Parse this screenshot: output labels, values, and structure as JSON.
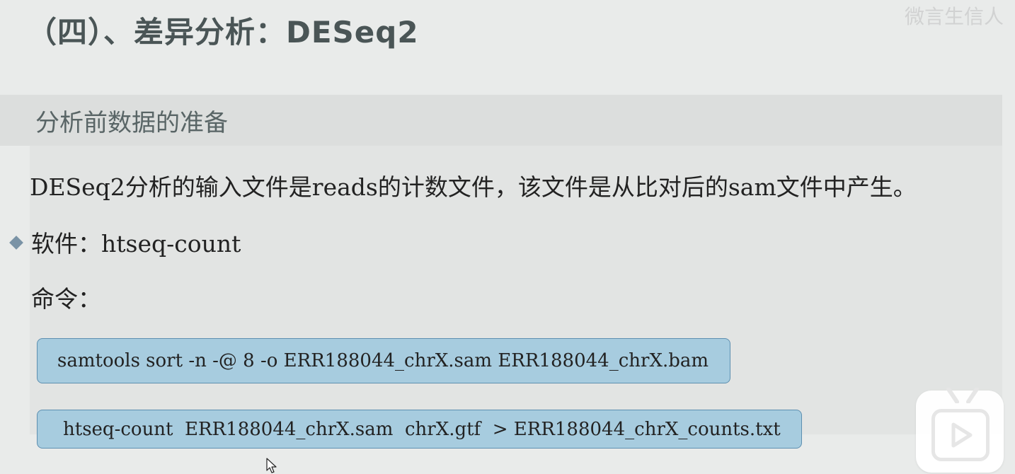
{
  "slide": {
    "title": "（四）、差异分析：DESeq2",
    "watermark": "微言生信人",
    "section_heading": "分析前数据的准备",
    "paragraph": "DESeq2分析的输入文件是reads的计数文件，该文件是从比对后的sam文件中产生。",
    "software_line": "软件：htseq-count",
    "command_label": "命令：",
    "commands": [
      "samtools sort -n -@ 8 -o ERR188044_chrX.sam ERR188044_chrX.bam",
      "htseq-count  ERR188044_chrX.sam  chrX.gtf  > ERR188044_chrX_counts.txt"
    ]
  },
  "icons": {
    "bullet": "diamond-bullet-icon",
    "play": "play-button-icon",
    "cursor": "mouse-cursor-icon"
  },
  "colors": {
    "title": "#4a5556",
    "section_band": "#dcdedd",
    "command_box_fill": "#a7ccdf",
    "command_box_border": "#5d8fb0",
    "bullet": "#7a93a6"
  }
}
